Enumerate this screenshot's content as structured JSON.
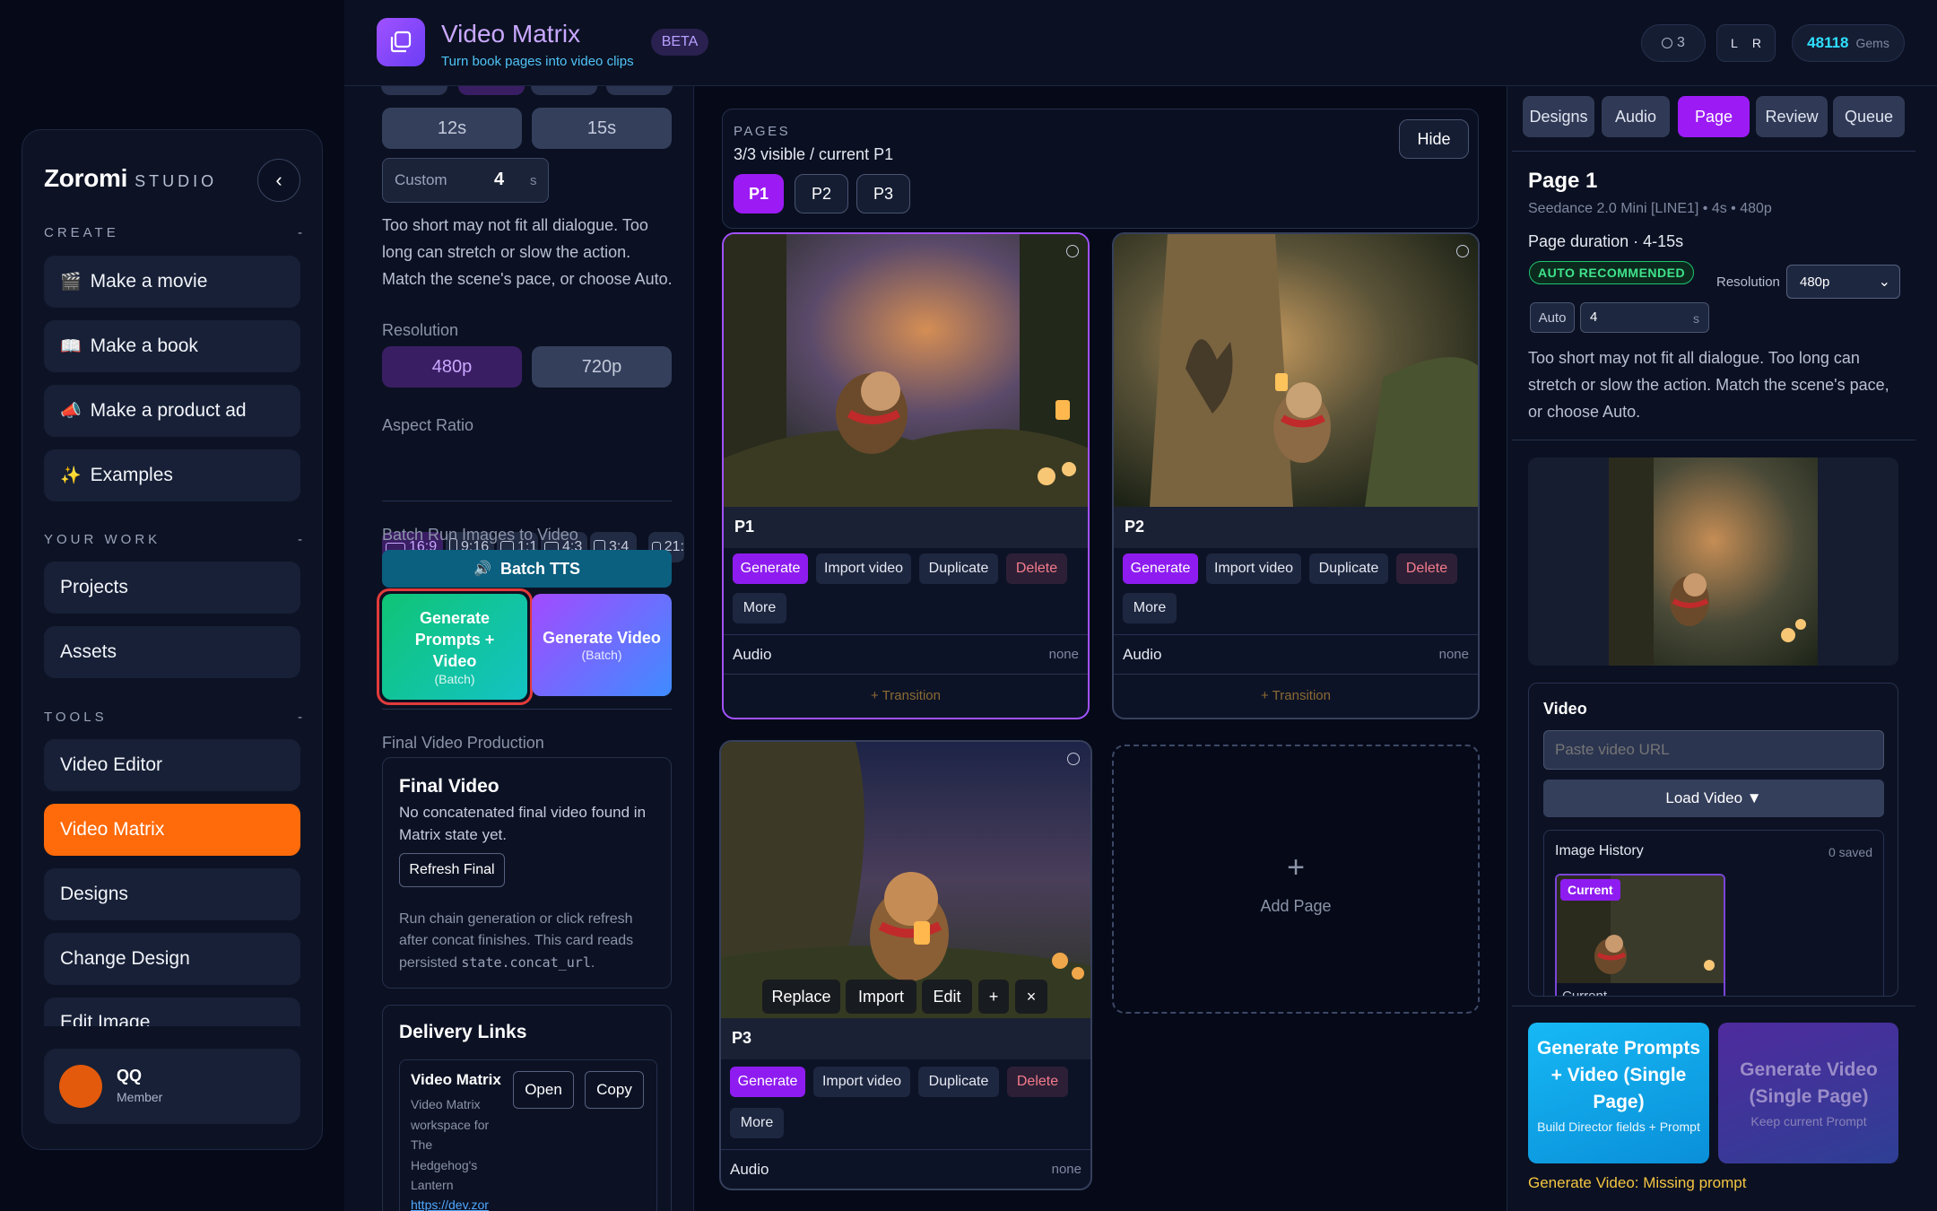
{
  "sidebar": {
    "brand": "Zoromi",
    "brand_suffix": "STUDIO",
    "sections": {
      "create": "CREATE",
      "your_work": "YOUR WORK",
      "tools": "TOOLS",
      "dash": "-"
    },
    "create_items": [
      {
        "icon": "🎬",
        "label": "Make a movie"
      },
      {
        "icon": "📖",
        "label": "Make a book"
      },
      {
        "icon": "📣",
        "label": "Make a product ad"
      },
      {
        "icon": "✨",
        "label": "Examples"
      }
    ],
    "work_items": [
      "Projects",
      "Assets"
    ],
    "tool_items": [
      "Video Editor",
      "Video Matrix",
      "Designs",
      "Change Design",
      "Edit Image"
    ],
    "user": {
      "name": "QQ",
      "role": "Member"
    }
  },
  "header": {
    "title": "Video Matrix",
    "subtitle": "Turn book pages into video clips",
    "badge": "BETA",
    "counter": "3",
    "lr": [
      "L",
      "R"
    ],
    "gems_value": "48118",
    "gems_label": "Gems"
  },
  "settings": {
    "durations": [
      "12s",
      "15s"
    ],
    "custom_label": "Custom",
    "custom_value": "4",
    "custom_unit": "s",
    "duration_help": "Too short may not fit all dialogue. Too long can stretch or slow the action. Match the scene's pace, or choose Auto.",
    "resolution_label": "Resolution",
    "resolutions": [
      "480p",
      "720p"
    ],
    "aspect_label": "Aspect Ratio",
    "aspects": [
      "16:9",
      "9:16",
      "1:1",
      "4:3",
      "3:4",
      "21:"
    ],
    "batch_label": "Batch Run Images to Video",
    "batch_tts": "Batch TTS",
    "gen_prompts_video": "Generate Prompts + Video",
    "gen_video": "Generate Video",
    "batch_suffix": "(Batch)",
    "final_label": "Final Video Production",
    "final_title": "Final Video",
    "final_desc": "No concatenated final video found in Matrix state yet.",
    "refresh_btn": "Refresh Final",
    "final_help": "Run chain generation or click refresh after concat finishes. This card reads persisted",
    "final_code": "state.concat_url",
    "delivery_title": "Delivery Links",
    "delivery_item_title": "Video Matrix",
    "delivery_item_desc": [
      "Video Matrix",
      "workspace for",
      "The",
      "Hedgehog's",
      "Lantern"
    ],
    "delivery_link": "https://dev.zor",
    "open_btn": "Open",
    "copy_btn": "Copy"
  },
  "pages": {
    "label": "PAGES",
    "status": "3/3 visible / current P1",
    "chips": [
      "P1",
      "P2",
      "P3"
    ],
    "hide_btn": "Hide",
    "cards": [
      {
        "id": "P1",
        "audio": "Audio",
        "audio_value": "none",
        "transition": "+ Transition"
      },
      {
        "id": "P2",
        "audio": "Audio",
        "audio_value": "none",
        "transition": "+ Transition"
      },
      {
        "id": "P3",
        "audio": "Audio",
        "audio_value": "none"
      }
    ],
    "actions": {
      "generate": "Generate",
      "import": "Import video",
      "duplicate": "Duplicate",
      "delete": "Delete",
      "more": "More"
    },
    "hover": {
      "replace": "Replace",
      "import": "Import",
      "edit": "Edit",
      "plus": "+",
      "close": "×"
    },
    "add_page": "Add Page",
    "add_icon": "+"
  },
  "right": {
    "tabs": [
      "Designs",
      "Audio",
      "Page",
      "Review",
      "Queue"
    ],
    "active_tab": "Page",
    "page_title": "Page 1",
    "model_line": "Seedance 2.0 Mini [LINE1] • 4s • 480p",
    "duration_label": "Page duration · 4-15s",
    "auto_badge": "AUTO RECOMMENDED",
    "resolution_label": "Resolution",
    "resolution_value": "480p",
    "auto_btn": "Auto",
    "duration_value": "4",
    "duration_unit": "s",
    "help": "Too short may not fit all dialogue. Too long can stretch or slow the action. Match the scene's pace, or choose Auto.",
    "video_label": "Video",
    "video_placeholder": "Paste video URL",
    "load_btn": "Load Video ▼",
    "history_label": "Image History",
    "history_count": "0 saved",
    "current_badge": "Current",
    "current_caption": "Current",
    "gen_single_1": "Generate Prompts + Video (Single Page)",
    "gen_single_1_sub": "Build Director fields + Prompt",
    "gen_single_2": "Generate Video (Single Page)",
    "gen_single_2_sub": "Keep current Prompt",
    "warning": "Generate Video: Missing prompt"
  },
  "colors": {
    "accent_purple": "#9c1bf5",
    "active_orange": "#ff6a0a",
    "teal": "#0c8fb0",
    "warning": "#f5c542"
  }
}
